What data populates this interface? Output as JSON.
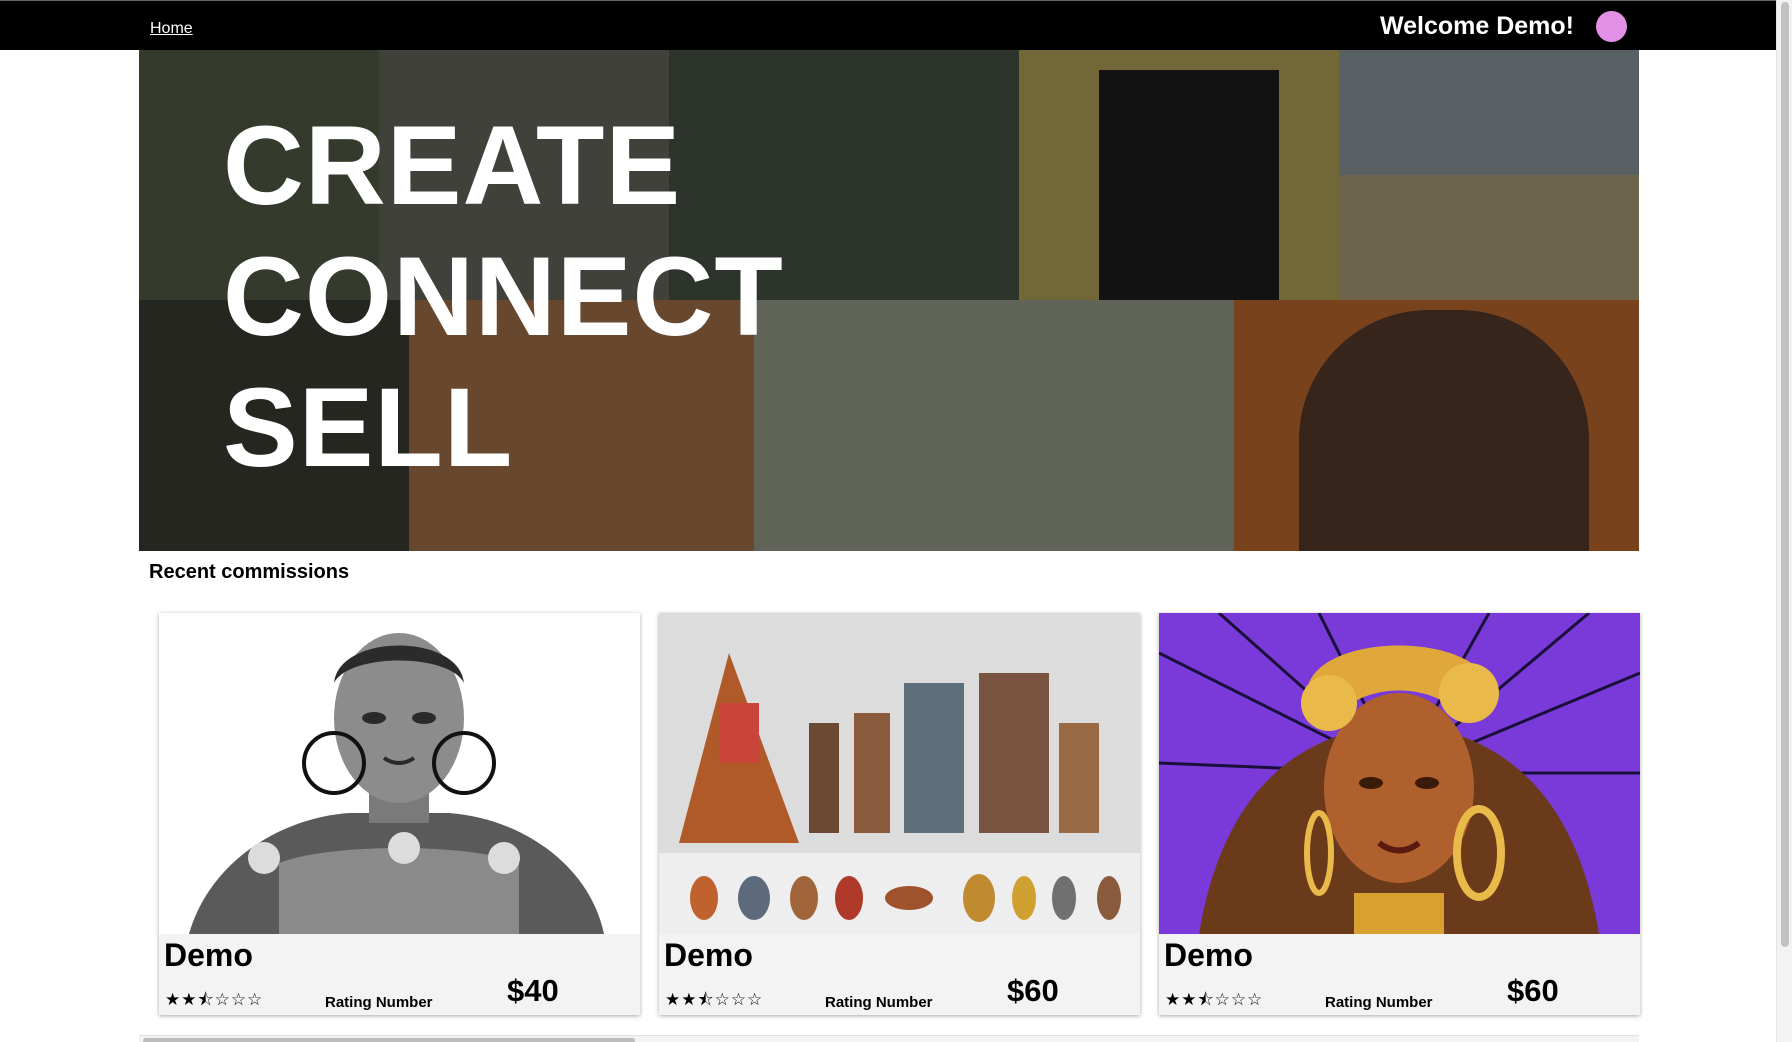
{
  "nav": {
    "home_label": "Home",
    "welcome_text": "Welcome Demo!",
    "avatar_color": "#e291e6"
  },
  "hero": {
    "lines": [
      "CREATE",
      "CONNECT",
      "SELL"
    ]
  },
  "section": {
    "title": "Recent commissions"
  },
  "cards": [
    {
      "name": "Demo",
      "stars": "★★⯪☆☆☆",
      "rating_label": "Rating Number",
      "price": "$40",
      "rating": 2.5,
      "image_icon": "portrait-artwork-bw"
    },
    {
      "name": "Demo",
      "stars": "★★⯪☆☆☆",
      "rating_label": "Rating Number",
      "price": "$60",
      "rating": 2.5,
      "image_icon": "character-lineup-artwork"
    },
    {
      "name": "Demo",
      "stars": "★★⯪☆☆☆",
      "rating_label": "Rating Number",
      "price": "$60",
      "rating": 2.5,
      "image_icon": "portrait-artwork-purple"
    }
  ],
  "colors": {
    "nav_bg": "#000000",
    "card_bg": "#f3f3f3",
    "purple_bg": "#7a3ad9"
  }
}
